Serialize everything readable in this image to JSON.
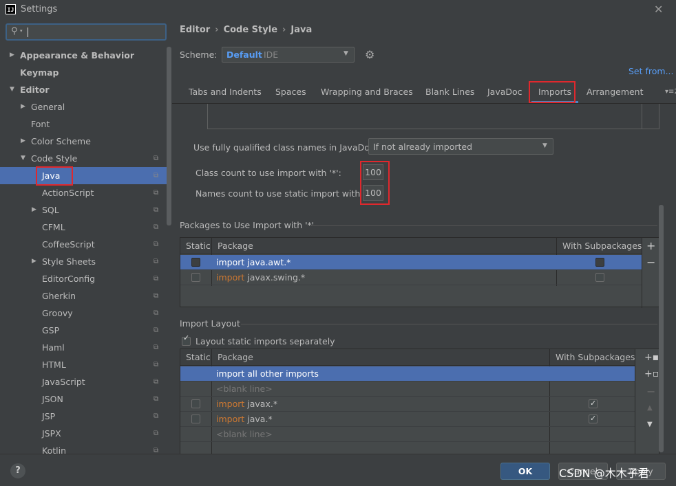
{
  "window": {
    "title": "Settings",
    "logo": "IJ"
  },
  "search": {
    "placeholder": ""
  },
  "tree": {
    "items": [
      {
        "label": "Appearance & Behavior",
        "level": 0,
        "arrow": "right",
        "bold": true
      },
      {
        "label": "Keymap",
        "level": 0,
        "arrow": "",
        "bold": true
      },
      {
        "label": "Editor",
        "level": 0,
        "arrow": "down",
        "bold": true
      },
      {
        "label": "General",
        "level": 1,
        "arrow": "right"
      },
      {
        "label": "Font",
        "level": 1,
        "arrow": ""
      },
      {
        "label": "Color Scheme",
        "level": 1,
        "arrow": "right"
      },
      {
        "label": "Code Style",
        "level": 1,
        "arrow": "down",
        "copy": true
      },
      {
        "label": "Java",
        "level": 2,
        "arrow": "",
        "copy": true,
        "selected": true
      },
      {
        "label": "ActionScript",
        "level": 2,
        "arrow": "",
        "copy": true
      },
      {
        "label": "SQL",
        "level": 2,
        "arrow": "right",
        "copy": true
      },
      {
        "label": "CFML",
        "level": 2,
        "arrow": "",
        "copy": true
      },
      {
        "label": "CoffeeScript",
        "level": 2,
        "arrow": "",
        "copy": true
      },
      {
        "label": "Style Sheets",
        "level": 2,
        "arrow": "right",
        "copy": true
      },
      {
        "label": "EditorConfig",
        "level": 2,
        "arrow": "",
        "copy": true
      },
      {
        "label": "Gherkin",
        "level": 2,
        "arrow": "",
        "copy": true
      },
      {
        "label": "Groovy",
        "level": 2,
        "arrow": "",
        "copy": true
      },
      {
        "label": "GSP",
        "level": 2,
        "arrow": "",
        "copy": true
      },
      {
        "label": "Haml",
        "level": 2,
        "arrow": "",
        "copy": true
      },
      {
        "label": "HTML",
        "level": 2,
        "arrow": "",
        "copy": true
      },
      {
        "label": "JavaScript",
        "level": 2,
        "arrow": "",
        "copy": true
      },
      {
        "label": "JSON",
        "level": 2,
        "arrow": "",
        "copy": true
      },
      {
        "label": "JSP",
        "level": 2,
        "arrow": "",
        "copy": true
      },
      {
        "label": "JSPX",
        "level": 2,
        "arrow": "",
        "copy": true
      },
      {
        "label": "Kotlin",
        "level": 2,
        "arrow": "",
        "copy": true
      }
    ]
  },
  "breadcrumb": [
    "Editor",
    "Code Style",
    "Java"
  ],
  "scheme": {
    "label": "Scheme:",
    "name": "Default",
    "kind": "IDE",
    "set_from": "Set from..."
  },
  "tabs": [
    {
      "label": "Tabs and Indents"
    },
    {
      "label": "Spaces"
    },
    {
      "label": "Wrapping and Braces"
    },
    {
      "label": "Blank Lines"
    },
    {
      "label": "JavaDoc"
    },
    {
      "label": "Imports",
      "active": true
    },
    {
      "label": "Arrangement"
    }
  ],
  "imports": {
    "fq_label": "Use fully qualified class names in JavaDoc:",
    "fq_value": "If not already imported",
    "class_count_label": "Class count to use import with '*':",
    "class_count_value": "100",
    "names_count_label": "Names count to use static import with '*':",
    "names_count_value": "100"
  },
  "packages_section": {
    "title": "Packages to Use Import with '*'",
    "headers": {
      "static": "Static",
      "package": "Package",
      "with_sub": "With Subpackages"
    },
    "rows": [
      {
        "static": false,
        "keyword": "import",
        "package": "java.awt.*",
        "with_sub": false,
        "selected": true
      },
      {
        "static": false,
        "keyword": "import",
        "package": "javax.swing.*",
        "with_sub": false,
        "selected": false
      }
    ]
  },
  "layout_section": {
    "title": "Import Layout",
    "layout_static_label": "Layout static imports separately",
    "layout_static_checked": true,
    "headers": {
      "static": "Static",
      "package": "Package",
      "with_sub": "With Subpackages"
    },
    "rows": [
      {
        "type": "all",
        "text": "import all other imports",
        "selected": true
      },
      {
        "type": "blank",
        "text": "<blank line>"
      },
      {
        "type": "pkg",
        "keyword": "import",
        "package": "javax.*",
        "with_sub": true
      },
      {
        "type": "pkg",
        "keyword": "import",
        "package": "java.*",
        "with_sub": true
      },
      {
        "type": "blank",
        "text": "<blank line>"
      }
    ]
  },
  "buttons": {
    "ok": "OK",
    "cancel": "Cancel",
    "apply": "Apply",
    "help": "?"
  },
  "watermark": "CSDN @木木子君"
}
